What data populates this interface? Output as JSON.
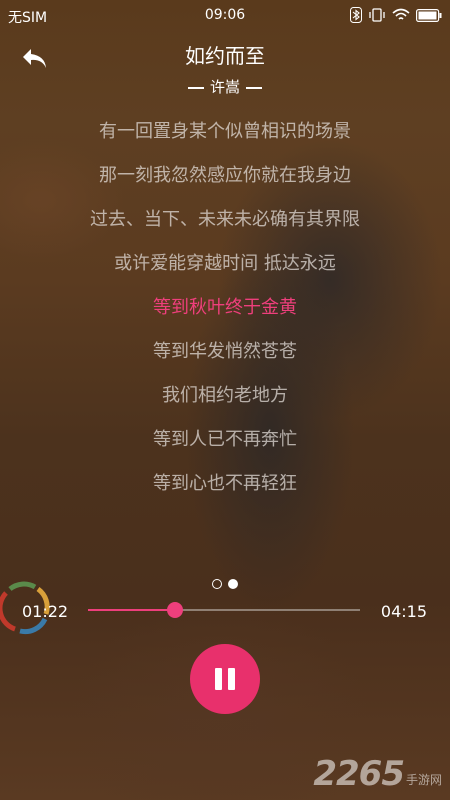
{
  "status_bar": {
    "carrier": "无SIM",
    "time": "09:06"
  },
  "header": {
    "back_icon": "back-arrow-icon",
    "title": "如约而至",
    "artist": "许嵩"
  },
  "lyrics": {
    "lines": [
      "有一回置身某个似曾相识的场景",
      "那一刻我忽然感应你就在我身边",
      "过去、当下、未来未必确有其界限",
      "或许爱能穿越时间 抵达永远",
      "等到秋叶终于金黄",
      "等到华发悄然苍苍",
      "我们相约老地方",
      "等到人已不再奔忙",
      "等到心也不再轻狂"
    ],
    "active_index": 4,
    "active_color": "#ee3f7c"
  },
  "pager": {
    "count": 2,
    "active": 1
  },
  "player": {
    "elapsed": "01:22",
    "total": "04:15",
    "progress_fraction": 0.32,
    "accent_color": "#ee3f7c",
    "pause_icon": "pause-icon"
  },
  "watermark": {
    "number": "2265",
    "text": "手游网"
  }
}
